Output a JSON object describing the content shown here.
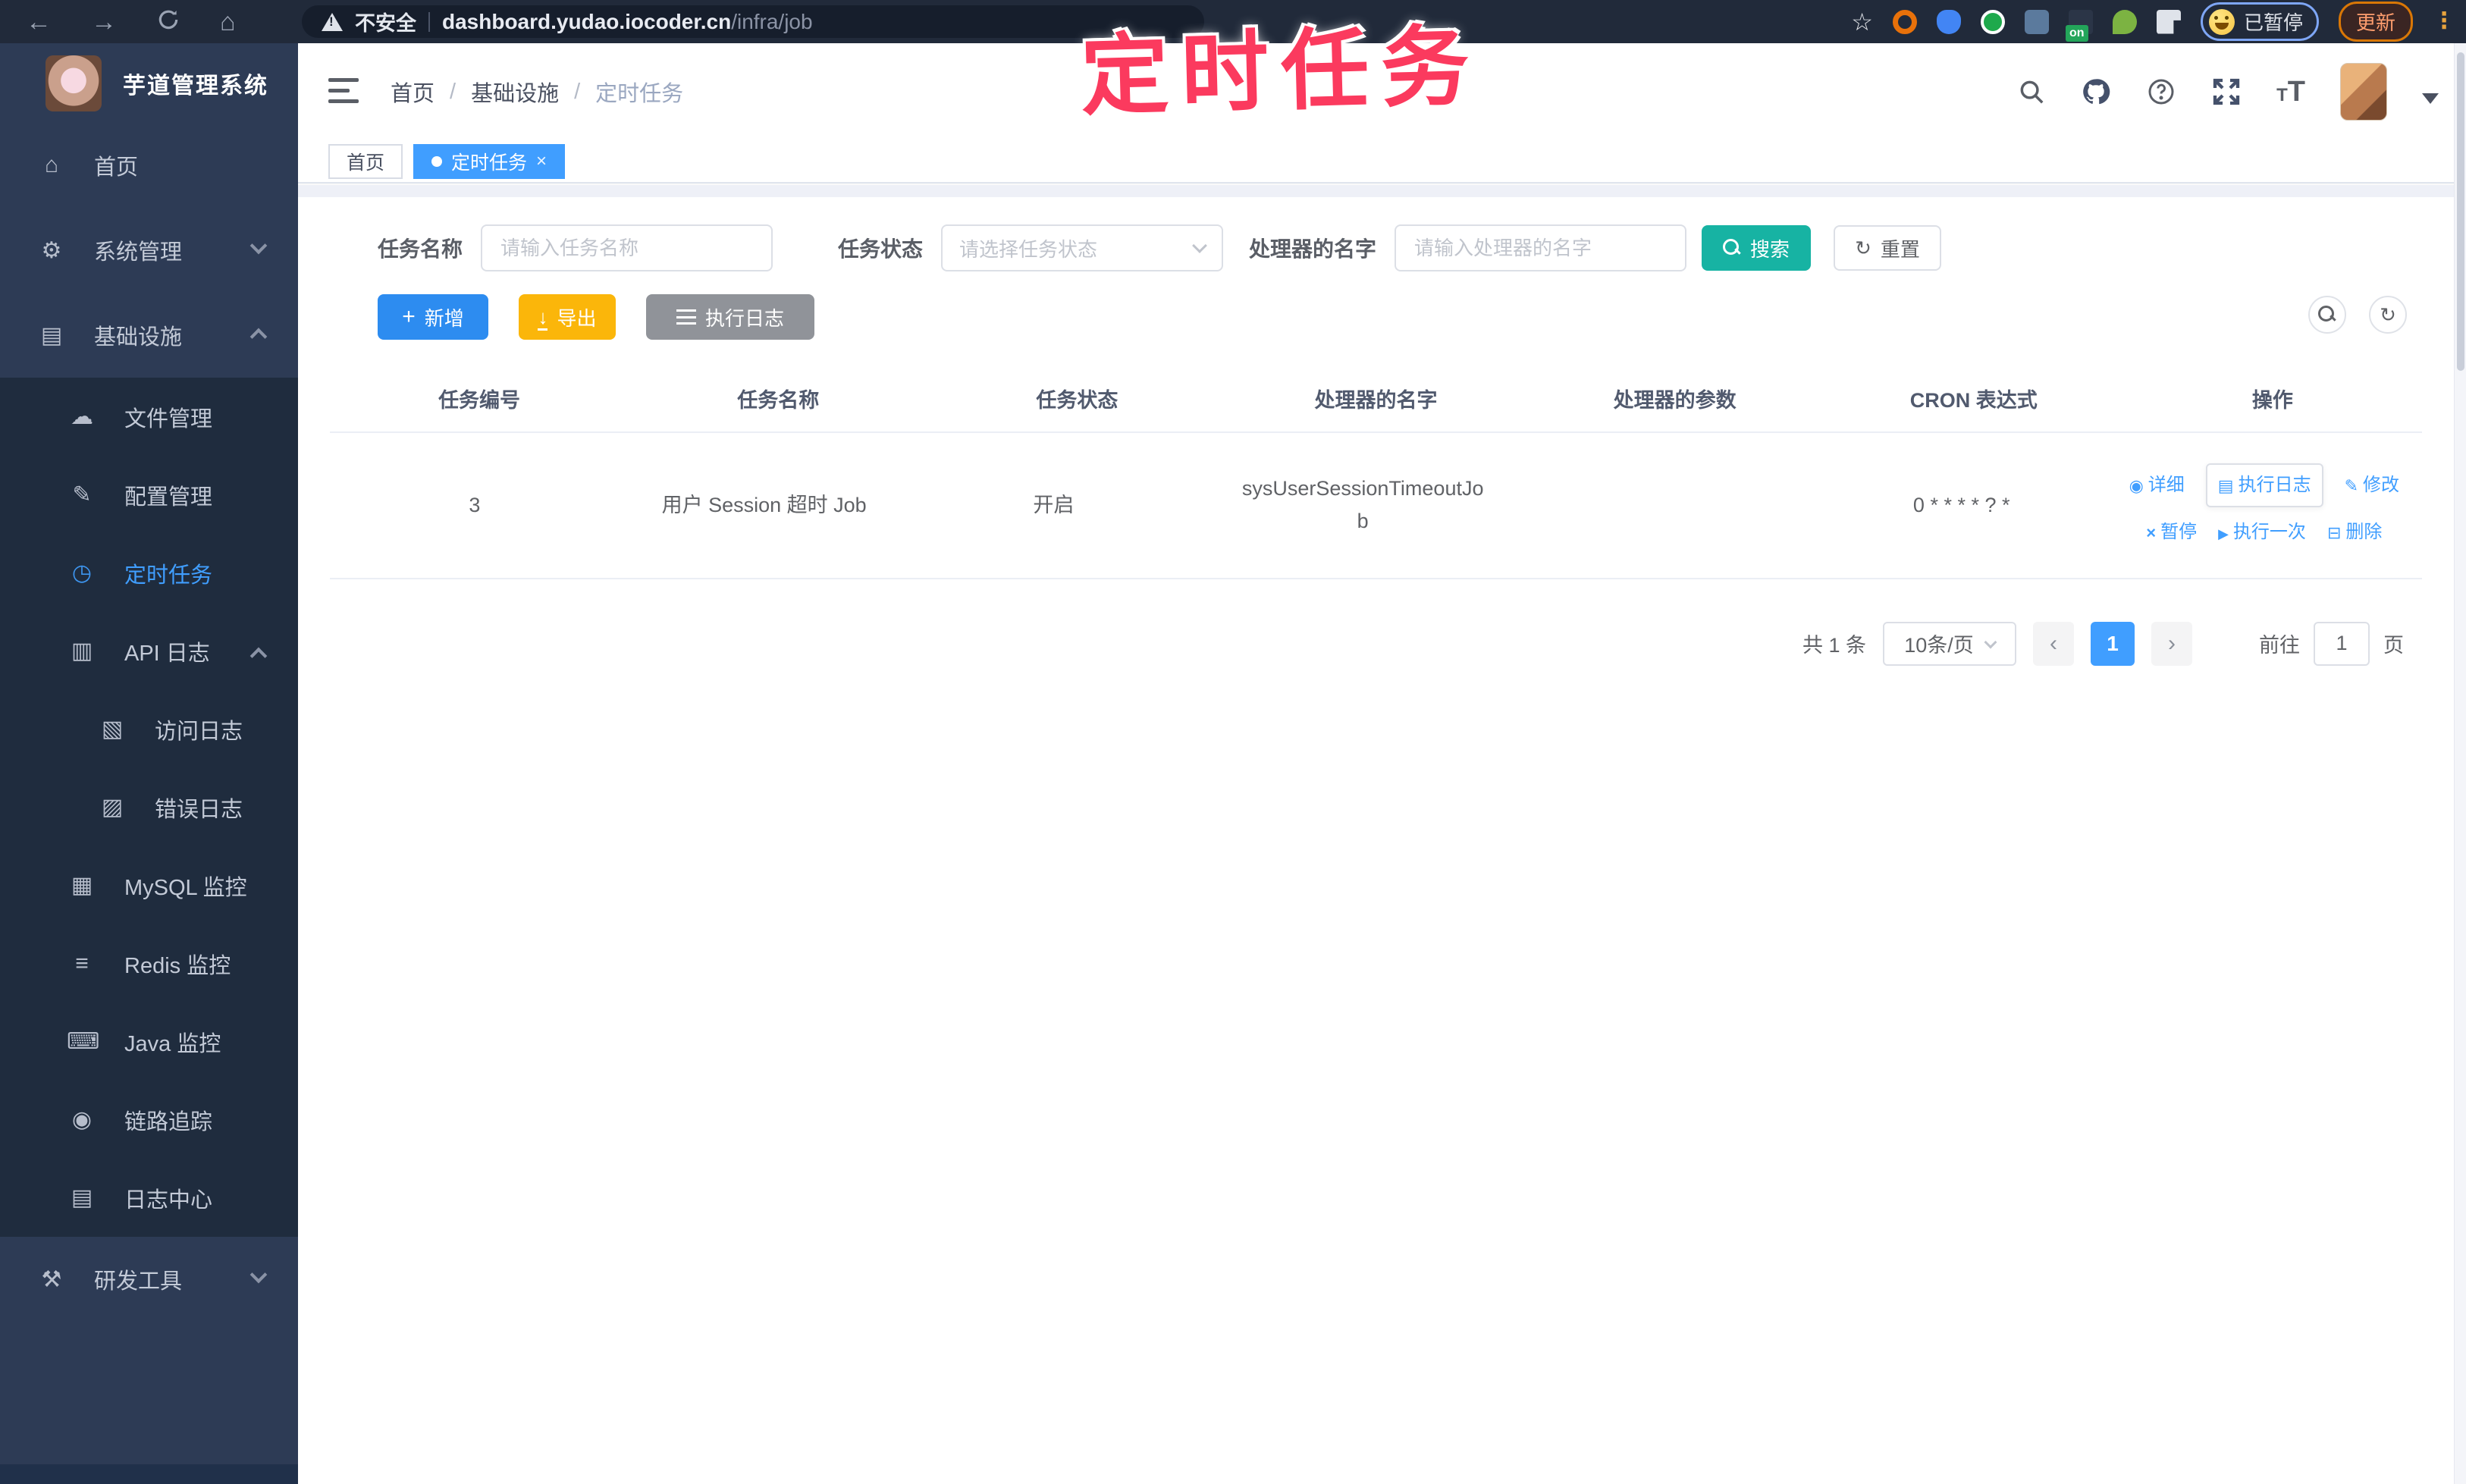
{
  "browser": {
    "warning_text": "不安全",
    "url_host": "dashboard.yudao.iocoder.cn",
    "url_path": "/infra/job",
    "extension_on_badge": "on",
    "paused_label": "已暂停",
    "update_label": "更新"
  },
  "annotation": {
    "text": "定时任务",
    "color": "#fb3a5e"
  },
  "sidebar": {
    "logo_title": "芋道管理系统",
    "items": [
      {
        "label": "首页"
      },
      {
        "label": "系统管理"
      },
      {
        "label": "基础设施"
      },
      {
        "label": "文件管理"
      },
      {
        "label": "配置管理"
      },
      {
        "label": "定时任务"
      },
      {
        "label": "API 日志"
      },
      {
        "label": "访问日志"
      },
      {
        "label": "错误日志"
      },
      {
        "label": "MySQL 监控"
      },
      {
        "label": "Redis 监控"
      },
      {
        "label": "Java 监控"
      },
      {
        "label": "链路追踪"
      },
      {
        "label": "日志中心"
      },
      {
        "label": "研发工具"
      }
    ]
  },
  "breadcrumb": {
    "sep": "/",
    "items": [
      "首页",
      "基础设施",
      "定时任务"
    ]
  },
  "tabs": [
    {
      "label": "首页"
    },
    {
      "label": "定时任务"
    }
  ],
  "filters": {
    "name_label": "任务名称",
    "name_placeholder": "请输入任务名称",
    "status_label": "任务状态",
    "status_placeholder": "请选择任务状态",
    "handler_label": "处理器的名字",
    "handler_placeholder": "请输入处理器的名字",
    "search_label": "搜索",
    "reset_label": "重置"
  },
  "toolbar": {
    "add_label": "新增",
    "export_label": "导出",
    "exec_log_label": "执行日志"
  },
  "table": {
    "columns": [
      "任务编号",
      "任务名称",
      "任务状态",
      "处理器的名字",
      "处理器的参数",
      "CRON 表达式",
      "操作"
    ],
    "row": {
      "id": "3",
      "name": "用户 Session 超时 Job",
      "status": "开启",
      "handler": "sysUserSessionTimeoutJob",
      "params": "",
      "cron": "0 * * * * ? *"
    },
    "actions": {
      "detail": "详细",
      "exec_log": "执行日志",
      "edit": "修改",
      "pause": "暂停",
      "run_once": "执行一次",
      "delete": "删除"
    }
  },
  "pagination": {
    "total": "共 1 条",
    "size": "10条/页",
    "page": "1",
    "goto_label": "前往",
    "goto_value": "1",
    "unit": "页"
  },
  "colors": {
    "accent": "#409eff",
    "search_button": "#17b3a3",
    "export_button": "#fbb60a",
    "annotation": "#fb3a5e"
  }
}
